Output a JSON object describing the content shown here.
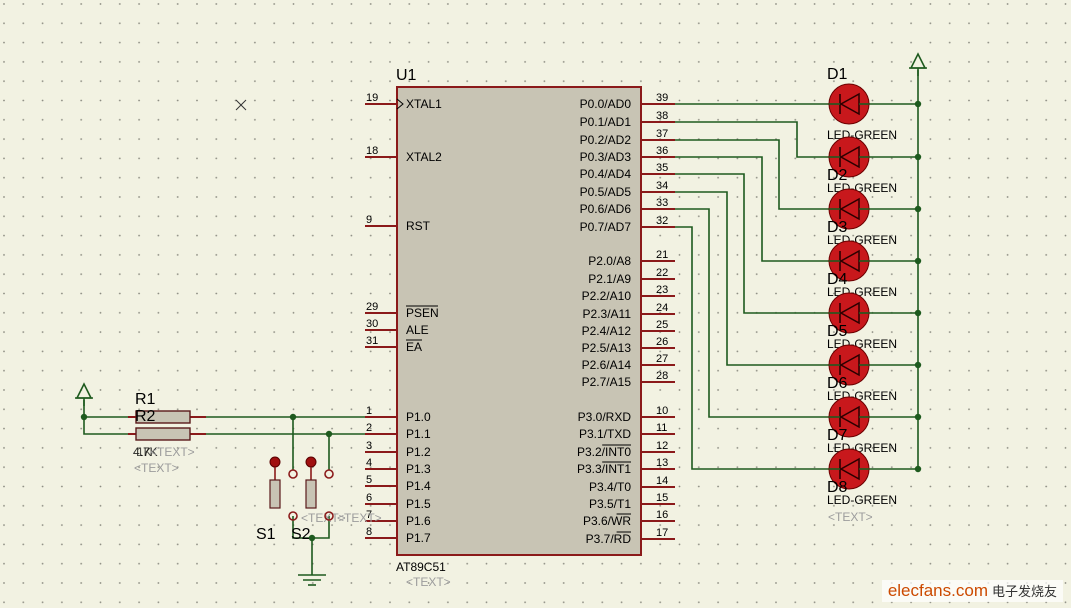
{
  "colors": {
    "background": "#f2f2e2",
    "chip_fill": "#c8c4b4",
    "chip_border": "#8b1a1a",
    "pin": "#8b1a1a",
    "wire": "#1e5a1e",
    "led": "#c8181c",
    "junction": "#1e5a1e",
    "placeholder": "#9c9c9c"
  },
  "mcu": {
    "ref": "U1",
    "part": "AT89C51",
    "text_tag": "<TEXT>",
    "left_pins": [
      {
        "num": "19",
        "name": "XTAL1",
        "clock": true
      },
      {
        "num": "18",
        "name": "XTAL2"
      },
      {
        "num": "9",
        "name": "RST"
      },
      {
        "num": "29",
        "name": "PSEN",
        "overline": true
      },
      {
        "num": "30",
        "name": "ALE"
      },
      {
        "num": "31",
        "name": "EA",
        "overline": true
      },
      {
        "num": "1",
        "name": "P1.0"
      },
      {
        "num": "2",
        "name": "P1.1"
      },
      {
        "num": "3",
        "name": "P1.2"
      },
      {
        "num": "4",
        "name": "P1.3"
      },
      {
        "num": "5",
        "name": "P1.4"
      },
      {
        "num": "6",
        "name": "P1.5"
      },
      {
        "num": "7",
        "name": "P1.6"
      },
      {
        "num": "8",
        "name": "P1.7"
      }
    ],
    "right_pins": [
      {
        "num": "39",
        "name": "P0.0/AD0"
      },
      {
        "num": "38",
        "name": "P0.1/AD1"
      },
      {
        "num": "37",
        "name": "P0.2/AD2"
      },
      {
        "num": "36",
        "name": "P0.3/AD3"
      },
      {
        "num": "35",
        "name": "P0.4/AD4"
      },
      {
        "num": "34",
        "name": "P0.5/AD5"
      },
      {
        "num": "33",
        "name": "P0.6/AD6"
      },
      {
        "num": "32",
        "name": "P0.7/AD7"
      },
      {
        "num": "21",
        "name": "P2.0/A8"
      },
      {
        "num": "22",
        "name": "P2.1/A9"
      },
      {
        "num": "23",
        "name": "P2.2/A10"
      },
      {
        "num": "24",
        "name": "P2.3/A11"
      },
      {
        "num": "25",
        "name": "P2.4/A12"
      },
      {
        "num": "26",
        "name": "P2.5/A13"
      },
      {
        "num": "27",
        "name": "P2.6/A14"
      },
      {
        "num": "28",
        "name": "P2.7/A15"
      },
      {
        "num": "10",
        "name": "P3.0/RXD"
      },
      {
        "num": "11",
        "name": "P3.1/TXD"
      },
      {
        "num": "12",
        "name": "P3.2/INT0",
        "overline_part": "INT0"
      },
      {
        "num": "13",
        "name": "P3.3/INT1",
        "overline_part": "INT1"
      },
      {
        "num": "14",
        "name": "P3.4/T0"
      },
      {
        "num": "15",
        "name": "P3.5/T1"
      },
      {
        "num": "16",
        "name": "P3.6/WR",
        "overline_part": "WR"
      },
      {
        "num": "17",
        "name": "P3.7/RD",
        "overline_part": "RD"
      }
    ]
  },
  "leds": {
    "type_label": "LED-GREEN",
    "text_tag": "<TEXT>",
    "first_ref": "D1",
    "overlap_refs": [
      "D2",
      "D3",
      "D4",
      "D5",
      "D6",
      "D7",
      "D8"
    ]
  },
  "resistors": {
    "r1": {
      "ref": "R1",
      "value": "4.7K",
      "text_tag": "<TEXT>"
    },
    "r2": {
      "ref": "R2",
      "value": "1K",
      "text_tag": "<TEXT>"
    }
  },
  "switches": {
    "s1": {
      "ref": "S1",
      "text_tag": "<TEXT>"
    },
    "s2": {
      "ref": "S2",
      "text_tag": "<TEXT>"
    }
  },
  "watermark": {
    "site": "elecfans",
    "domain": ".com",
    "cn": "电子发烧友"
  }
}
